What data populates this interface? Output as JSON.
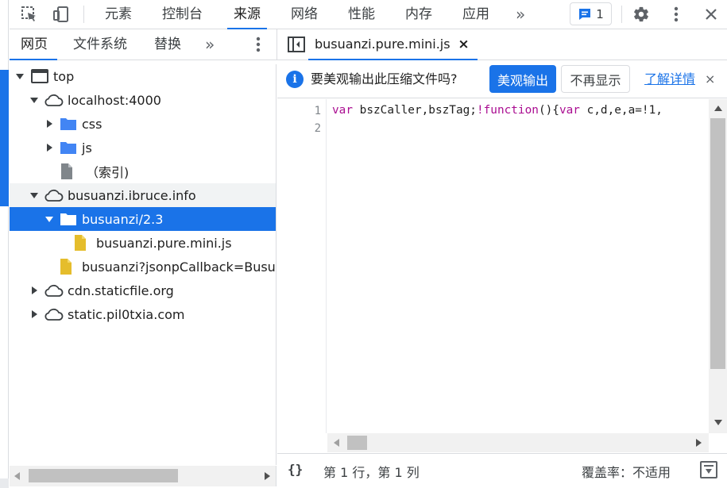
{
  "toolbar": {
    "tabs": [
      "元素",
      "控制台",
      "来源",
      "网络",
      "性能",
      "内存",
      "应用"
    ],
    "active_tab": "来源",
    "more": "»",
    "issues_count": "1"
  },
  "navigator": {
    "tabs": [
      "网页",
      "文件系统",
      "替换"
    ],
    "more": "»",
    "tree": [
      {
        "label": "top"
      },
      {
        "label": "localhost:4000"
      },
      {
        "label": "css"
      },
      {
        "label": "js"
      },
      {
        "label": "（索引)"
      },
      {
        "label": "busuanzi.ibruce.info"
      },
      {
        "label": "busuanzi/2.3"
      },
      {
        "label": "busuanzi.pure.mini.js"
      },
      {
        "label": "busuanzi?jsonpCallback=BusuanziCallback"
      },
      {
        "label": "cdn.staticfile.org"
      },
      {
        "label": "static.pil0txia.com"
      }
    ]
  },
  "editor": {
    "file_tab": "busuanzi.pure.mini.js",
    "close": "×",
    "infobar": {
      "text": "要美观输出此压缩文件吗?",
      "primary": "美观输出",
      "secondary": "不再显示",
      "link": "了解详情",
      "close": "×"
    },
    "line_numbers": [
      "1",
      "2"
    ],
    "code_line1": {
      "t1": "var",
      "t2": " bszCaller,bszTag;",
      "t3": "!function",
      "t4": "(){",
      "t5": "var",
      "t6": " c,d,e,a=!1,"
    }
  },
  "status": {
    "braces": "{}",
    "position": "第 1 行，第 1 列",
    "coverage": "覆盖率：不适用"
  },
  "colors": {
    "accent": "#1a73e8",
    "keyword": "#aa0d91"
  }
}
